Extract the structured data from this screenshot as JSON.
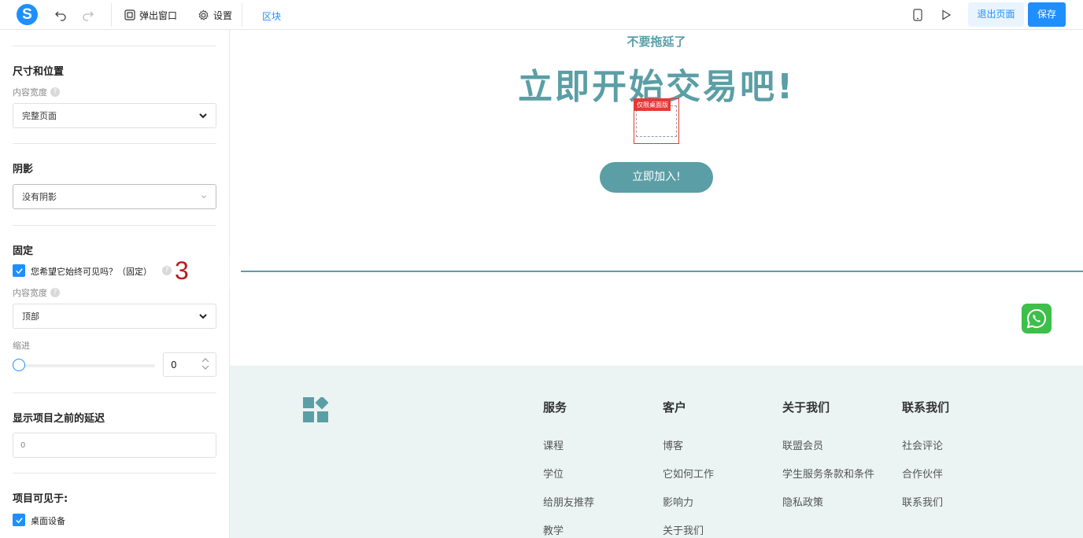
{
  "toolbar": {
    "logo_letter": "S",
    "popup_label": "弹出窗口",
    "settings_label": "设置",
    "block_link": "区块",
    "exit_label": "退出页面",
    "save_label": "保存"
  },
  "sidebar": {
    "size_section": "尺寸和位置",
    "content_width_label": "内容宽度",
    "content_width_value": "完整页面",
    "shadow_section": "阴影",
    "shadow_value": "没有阴影",
    "fixed_section": "固定",
    "fixed_checkbox_label": "您希望它始终可见吗？（固定）",
    "annotation_number": "3",
    "fixed_width_label": "内容宽度",
    "fixed_width_value": "顶部",
    "indent_label": "缩进",
    "indent_value": "0",
    "delay_section": "显示项目之前的延迟",
    "delay_value": "0",
    "visible_section": "项目可见于:",
    "desktop_label": "桌面设备"
  },
  "canvas": {
    "subhead": "不要拖延了",
    "headline": "立即开始交易吧!",
    "desktop_only_tag": "仅限桌面版",
    "join_button": "立即加入!"
  },
  "footer": {
    "columns": [
      {
        "title": "服务",
        "items": [
          "课程",
          "学位",
          "给朋友推荐",
          "教学"
        ]
      },
      {
        "title": "客户",
        "items": [
          "博客",
          "它如何工作",
          "影响力",
          "关于我们"
        ]
      },
      {
        "title": "关于我们",
        "items": [
          "联盟会员",
          "学生服务条款和条件",
          "隐私政策"
        ]
      },
      {
        "title": "联系我们",
        "items": [
          "社会评论",
          "合作伙伴",
          "联系我们"
        ]
      }
    ]
  },
  "colors": {
    "accent": "#1f8fff",
    "teal": "#5b9ea6",
    "footer_bg": "#ebf3f3",
    "tag_red": "#e53935"
  }
}
